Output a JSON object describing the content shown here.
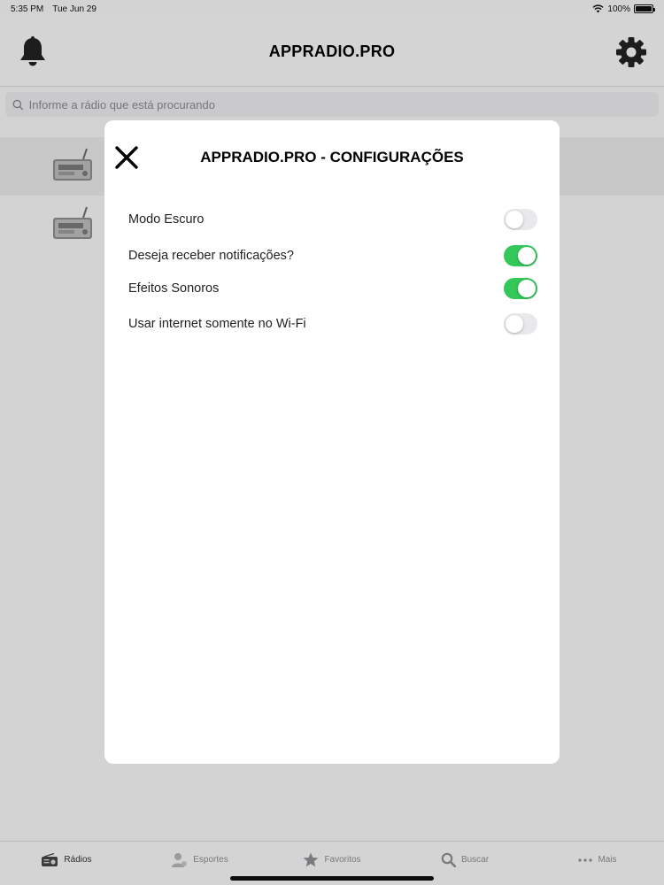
{
  "statusbar": {
    "time": "5:35 PM",
    "date": "Tue Jun 29",
    "battery": "100%"
  },
  "navbar": {
    "title": "APPRADIO.PRO",
    "left_icon": "bell-icon",
    "right_icon": "gear-icon"
  },
  "search": {
    "placeholder": "Informe a rádio que está procurando"
  },
  "tabs": [
    {
      "label": "Rádios",
      "icon": "radio-icon"
    },
    {
      "label": "Esportes",
      "icon": "sports-icon"
    },
    {
      "label": "Favoritos",
      "icon": "star-icon"
    },
    {
      "label": "Buscar",
      "icon": "search-icon"
    },
    {
      "label": "Mais",
      "icon": "more-icon"
    }
  ],
  "modal": {
    "title": "APPRADIO.PRO - CONFIGURAÇÕES",
    "settings": [
      {
        "label": "Modo Escuro",
        "enabled": false
      },
      {
        "label": "Deseja receber notificações?",
        "enabled": true
      },
      {
        "label": "Efeitos Sonoros",
        "enabled": true
      },
      {
        "label": "Usar internet somente no Wi-Fi",
        "enabled": false
      }
    ]
  },
  "colors": {
    "toggle_on": "#34c759",
    "toggle_off": "#e9e9eb"
  }
}
